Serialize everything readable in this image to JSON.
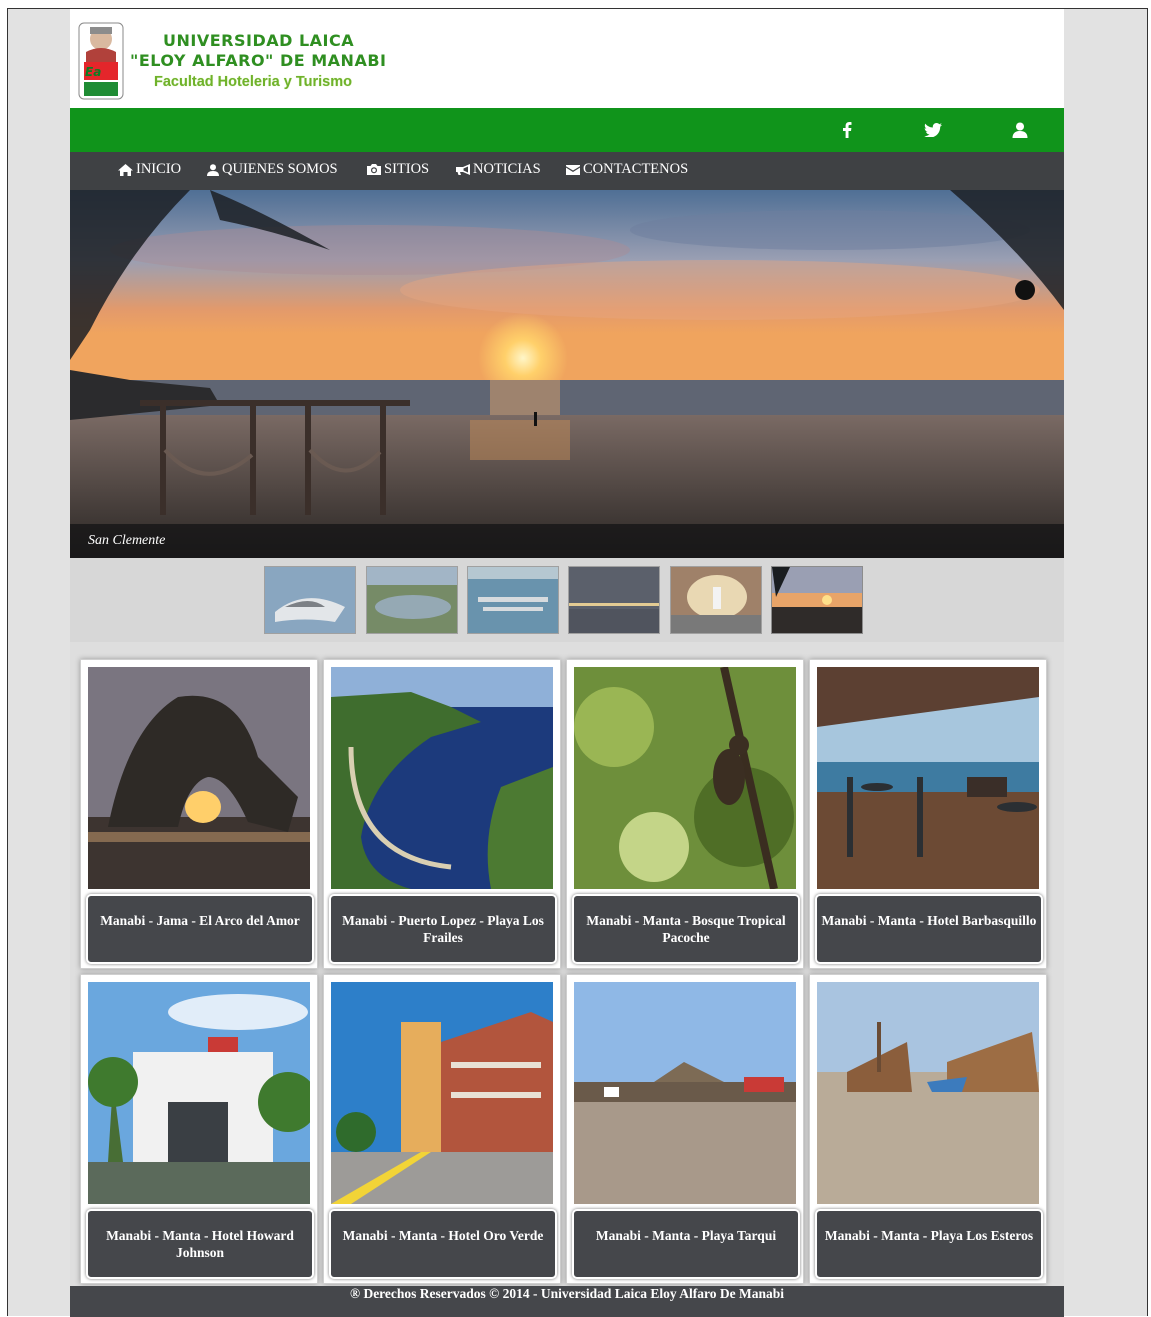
{
  "header": {
    "title_line1": "UNIVERSIDAD LAICA",
    "title_line2": "\"ELOY ALFARO\" DE MANABI",
    "subtitle": "Facultad Hoteleria y Turismo",
    "logo_icon": "university-seal-logo"
  },
  "social": {
    "icons": [
      "facebook-icon",
      "twitter-icon",
      "user-icon"
    ]
  },
  "nav": {
    "items": [
      {
        "label": "INICIO",
        "icon": "home-icon"
      },
      {
        "label": "QUIENES SOMOS",
        "icon": "user-icon"
      },
      {
        "label": "SITIOS",
        "icon": "camera-icon"
      },
      {
        "label": "NOTICIAS",
        "icon": "megaphone-icon"
      },
      {
        "label": "CONTACTENOS",
        "icon": "envelope-icon"
      }
    ]
  },
  "slider": {
    "caption": "San Clemente",
    "active_thumb": 6
  },
  "cards": [
    {
      "label": "Manabi - Jama - El Arco del Amor"
    },
    {
      "label": "Manabi - Puerto Lopez - Playa Los Frailes"
    },
    {
      "label": "Manabi - Manta - Bosque Tropical Pacoche"
    },
    {
      "label": "Manabi - Manta - Hotel Barbasquillo"
    },
    {
      "label": "Manabi - Manta - Hotel Howard Johnson"
    },
    {
      "label": "Manabi - Manta - Hotel Oro Verde"
    },
    {
      "label": "Manabi - Manta - Playa Tarqui"
    },
    {
      "label": "Manabi - Manta - Playa Los Esteros"
    }
  ],
  "footer": {
    "text": "® Derechos Reservados © 2014  -  Universidad Laica Eloy Alfaro De Manabi"
  },
  "colors": {
    "green_bar": "#10941b",
    "nav_dark": "#3f4144",
    "title_green": "#2f8f21"
  }
}
